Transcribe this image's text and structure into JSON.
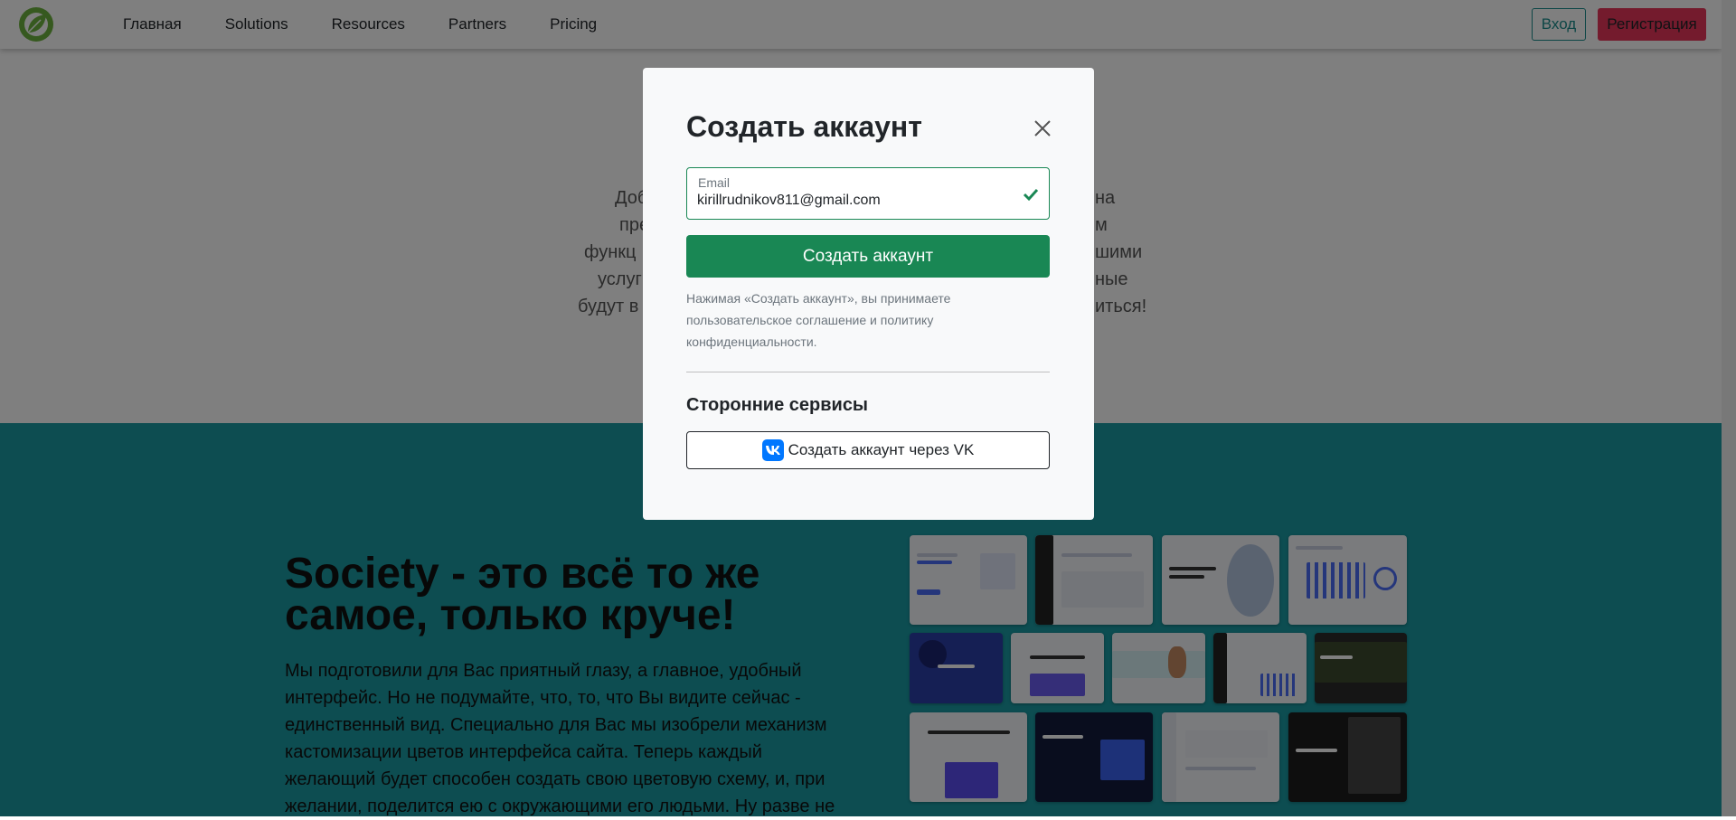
{
  "nav": {
    "logo": "leaf-logo-icon",
    "links": [
      "Главная",
      "Solutions",
      "Resources",
      "Partners",
      "Pricing"
    ],
    "login": "Вход",
    "register": "Регистрация"
  },
  "hero": {
    "lines": [
      "Доб",
      "пре",
      "функц",
      "услуг",
      "будут в"
    ],
    "lines_right": [
      "на",
      "м",
      "шими",
      "ные",
      "иться!"
    ]
  },
  "feature": {
    "title": "Society - это всё то же самое, только круче!",
    "body": "Мы подготовили для Вас приятный глазу, а главное, удобный интерфейс. Но не подумайте, что, то, что Вы видите сейчас - единственный вид. Специально для Вас мы изобрели механизм кастомизации цветов интерфейса сайта. Теперь каждый желающий будет способен создать свою цветовую схему, и, при желании, поделится ею с окружающими его людьми. Ну разве не"
  },
  "modal": {
    "title": "Создать аккаунт",
    "email_label": "Email",
    "email_value": "kirillrudnikov811@gmail.com",
    "submit": "Создать аккаунт",
    "terms": "Нажимая «Создать аккаунт», вы принимаете пользовательское соглашение и политику конфиденциальности.",
    "third_party_title": "Сторонние сервисы",
    "vk_button": "Создать аккаунт через VK"
  },
  "colors": {
    "accent_green": "#198754",
    "teal": "#1a9aa3",
    "register_pink": "#e8365a",
    "vk_blue": "#0077ff"
  }
}
